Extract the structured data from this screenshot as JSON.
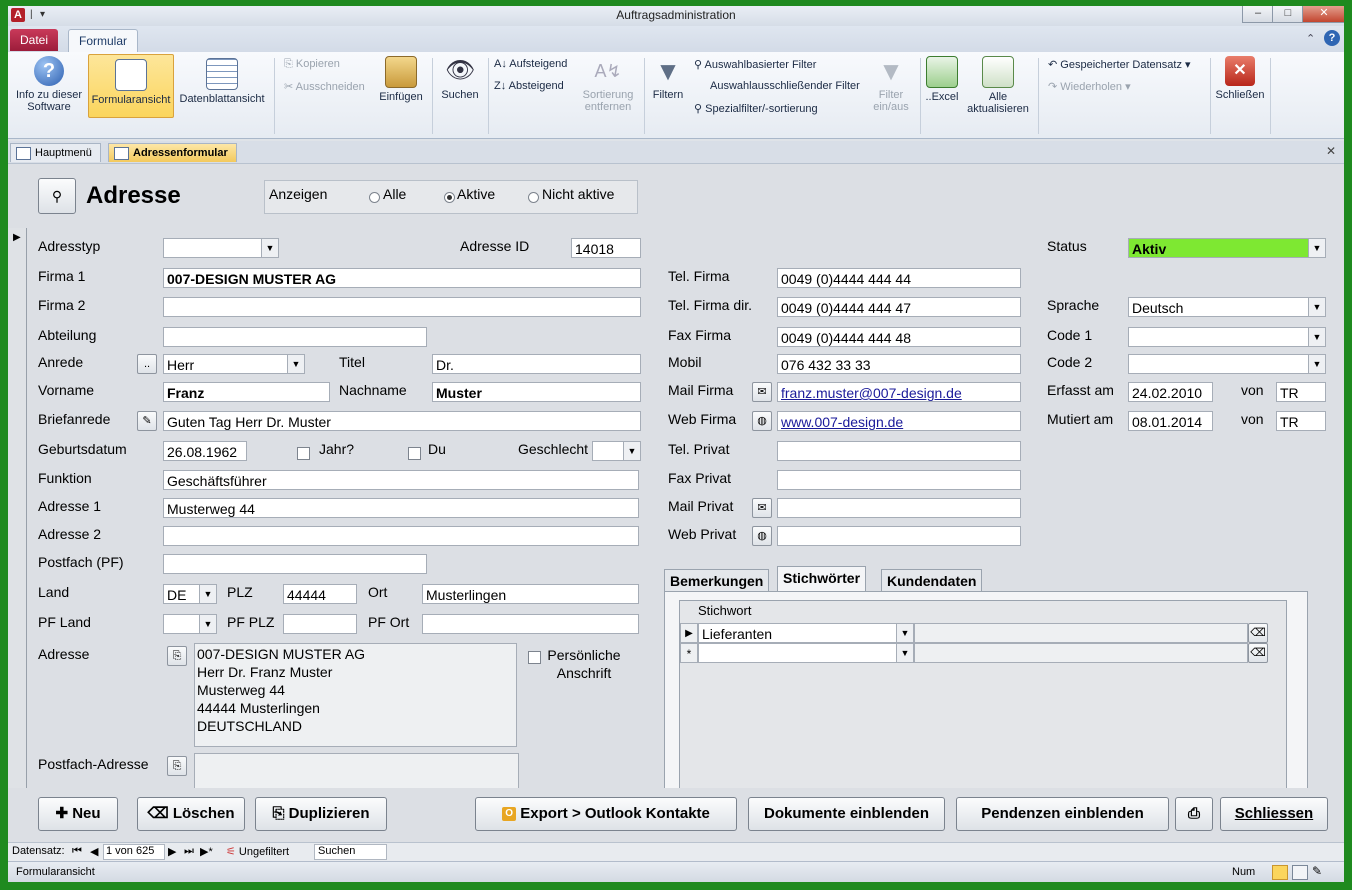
{
  "window": {
    "title": "Auftragsadministration"
  },
  "ribbon": {
    "tabs": [
      "Datei",
      "Formular"
    ],
    "buttons": {
      "info": "Info zu dieser Software",
      "formular": "Formularansicht",
      "datenblatt": "Datenblattansicht",
      "kopieren": "Kopieren",
      "ausschneiden": "Ausschneiden",
      "einfuegen": "Einfügen",
      "suchen": "Suchen",
      "aufsteigend": "Aufsteigend",
      "absteigend": "Absteigend",
      "sortierung": "Sortierung entfernen",
      "filtern": "Filtern",
      "auswahlbasiert": "Auswahlbasierter Filter",
      "auswahlausschliessend": "Auswahlausschließender Filter",
      "spezialfilter": "Spezialfilter/-sortierung",
      "filter_einaus": "Filter ein/aus",
      "excel": "..Excel",
      "alle_aktualisieren": "Alle aktualisieren",
      "gespeichert": "Gespeicherter Datensatz",
      "wiederholen": "Wiederholen",
      "schliessen": "Schließen"
    }
  },
  "doc_tabs": [
    "Hauptmenü",
    "Adressenformular"
  ],
  "form": {
    "title": "Adresse",
    "anzeigen": {
      "label": "Anzeigen",
      "options": [
        "Alle",
        "Aktive",
        "Nicht aktive"
      ],
      "selected": "Aktive"
    },
    "labels": {
      "adresstyp": "Adresstyp",
      "adresse_id": "Adresse ID",
      "firma1": "Firma 1",
      "firma2": "Firma 2",
      "abteilung": "Abteilung",
      "anrede": "Anrede",
      "titel": "Titel",
      "vorname": "Vorname",
      "nachname": "Nachname",
      "briefanrede": "Briefanrede",
      "geburtsdatum": "Geburtsdatum",
      "jahr": "Jahr?",
      "du": "Du",
      "geschlecht": "Geschlecht",
      "funktion": "Funktion",
      "adresse1": "Adresse 1",
      "adresse2": "Adresse 2",
      "postfach": "Postfach (PF)",
      "land": "Land",
      "plz": "PLZ",
      "ort": "Ort",
      "pf_land": "PF Land",
      "pf_plz": "PF PLZ",
      "pf_ort": "PF Ort",
      "adresse": "Adresse",
      "persoenliche": "Persönliche Anschrift",
      "postfach_adresse": "Postfach-Adresse",
      "tel_firma": "Tel. Firma",
      "tel_firma_dir": "Tel. Firma dir.",
      "fax_firma": "Fax Firma",
      "mobil": "Mobil",
      "mail_firma": "Mail Firma",
      "web_firma": "Web Firma",
      "tel_privat": "Tel. Privat",
      "fax_privat": "Fax Privat",
      "mail_privat": "Mail Privat",
      "web_privat": "Web Privat",
      "status": "Status",
      "sprache": "Sprache",
      "code1": "Code 1",
      "code2": "Code 2",
      "erfasst": "Erfasst am",
      "mutiert": "Mutiert am",
      "von": "von"
    },
    "values": {
      "adresse_id": "14018",
      "firma1": "007-DESIGN MUSTER AG",
      "anrede": "Herr",
      "titel": "Dr.",
      "vorname": "Franz",
      "nachname": "Muster",
      "briefanrede": "Guten Tag Herr Dr. Muster",
      "geburtsdatum": "26.08.1962",
      "funktion": "Geschäftsführer",
      "adresse1": "Musterweg 44",
      "land": "DE",
      "plz": "44444",
      "ort": "Musterlingen",
      "adresse_block": [
        "007-DESIGN MUSTER AG",
        "Herr Dr. Franz Muster",
        "Musterweg 44",
        "44444 Musterlingen",
        "DEUTSCHLAND"
      ],
      "tel_firma": "0049 (0)4444 444 44",
      "tel_firma_dir": "0049 (0)4444 444 47",
      "fax_firma": "0049 (0)4444 444 48",
      "mobil": "076 432 33 33",
      "mail_firma": "franz.muster@007-design.de",
      "web_firma": "www.007-design.de",
      "status": "Aktiv",
      "sprache": "Deutsch",
      "erfasst": "24.02.2010",
      "erfasst_von": "TR",
      "mutiert": "08.01.2014",
      "mutiert_von": "TR"
    },
    "subtabs": [
      "Bemerkungen",
      "Stichwörter",
      "Kundendaten"
    ],
    "stichwort": {
      "header": "Stichwort",
      "rows": [
        "Lieferanten"
      ]
    }
  },
  "buttons": {
    "neu": "Neu",
    "loeschen": "Löschen",
    "duplizieren": "Duplizieren",
    "export": "Export > Outlook Kontakte",
    "dokumente": "Dokumente einblenden",
    "pendenzen": "Pendenzen einblenden",
    "schliessen": "Schliessen"
  },
  "navbar": {
    "label": "Datensatz:",
    "record": "1 von 625",
    "filter": "Ungefiltert",
    "search": "Suchen"
  },
  "statusbar": {
    "left": "Formularansicht",
    "right": "Num"
  },
  "colors": {
    "status_bg": "#7ee832",
    "active_tab": "#f3c95d",
    "outer_bg": "#1f8a1f"
  }
}
